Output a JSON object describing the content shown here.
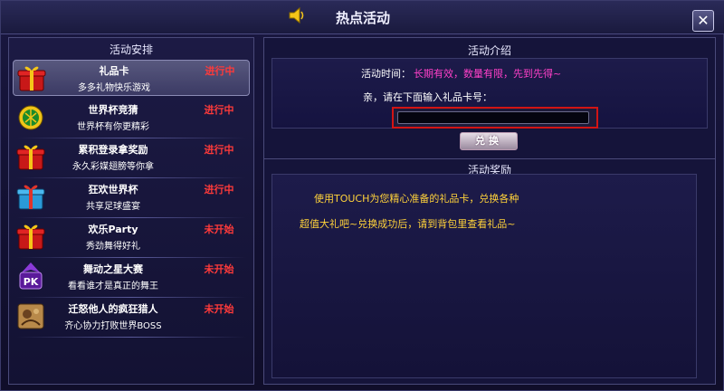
{
  "window": {
    "title": "热点活动",
    "close_label": "✕"
  },
  "left": {
    "header": "活动安排",
    "activities": [
      {
        "name": "礼品卡",
        "desc": "多多礼物快乐游戏",
        "status": "进行中",
        "icon": "gift-icon"
      },
      {
        "name": "世界杯竞猜",
        "desc": "世界杯有你更精彩",
        "status": "进行中",
        "icon": "football-icon"
      },
      {
        "name": "累积登录拿奖励",
        "desc": "永久彩媒翅膀等你拿",
        "status": "进行中",
        "icon": "gift-icon"
      },
      {
        "name": "狂欢世界杯",
        "desc": "共享足球盛宴",
        "status": "进行中",
        "icon": "blue-gift-icon"
      },
      {
        "name": "欢乐Party",
        "desc": "秀劲舞得好礼",
        "status": "未开始",
        "icon": "gift-icon"
      },
      {
        "name": "舞动之星大赛",
        "desc": "看看谁才是真正的舞王",
        "status": "未开始",
        "icon": "pk-icon"
      },
      {
        "name": "迁怒他人的疯狂猎人",
        "desc": "齐心协力打败世界BOSS",
        "status": "未开始",
        "icon": "hunter-icon"
      }
    ]
  },
  "intro": {
    "header": "活动介绍",
    "time_label": "活动时间：",
    "time_value": "长期有效，数量有限，先到先得~",
    "prompt": "亲，请在下面输入礼品卡号：",
    "code_value": "",
    "redeem_label": "兑换"
  },
  "reward": {
    "header": "活动奖励",
    "line1": "使用TOUCH为您精心准备的礼品卡，兑换各种",
    "line2": "超值大礼吧~兑换成功后，请到背包里查看礼品~"
  },
  "colors": {
    "status_red": "#ff3a3a",
    "time_magenta": "#ff40c8",
    "reward_yellow": "#ffd23a",
    "highlight_border": "#d21414"
  }
}
